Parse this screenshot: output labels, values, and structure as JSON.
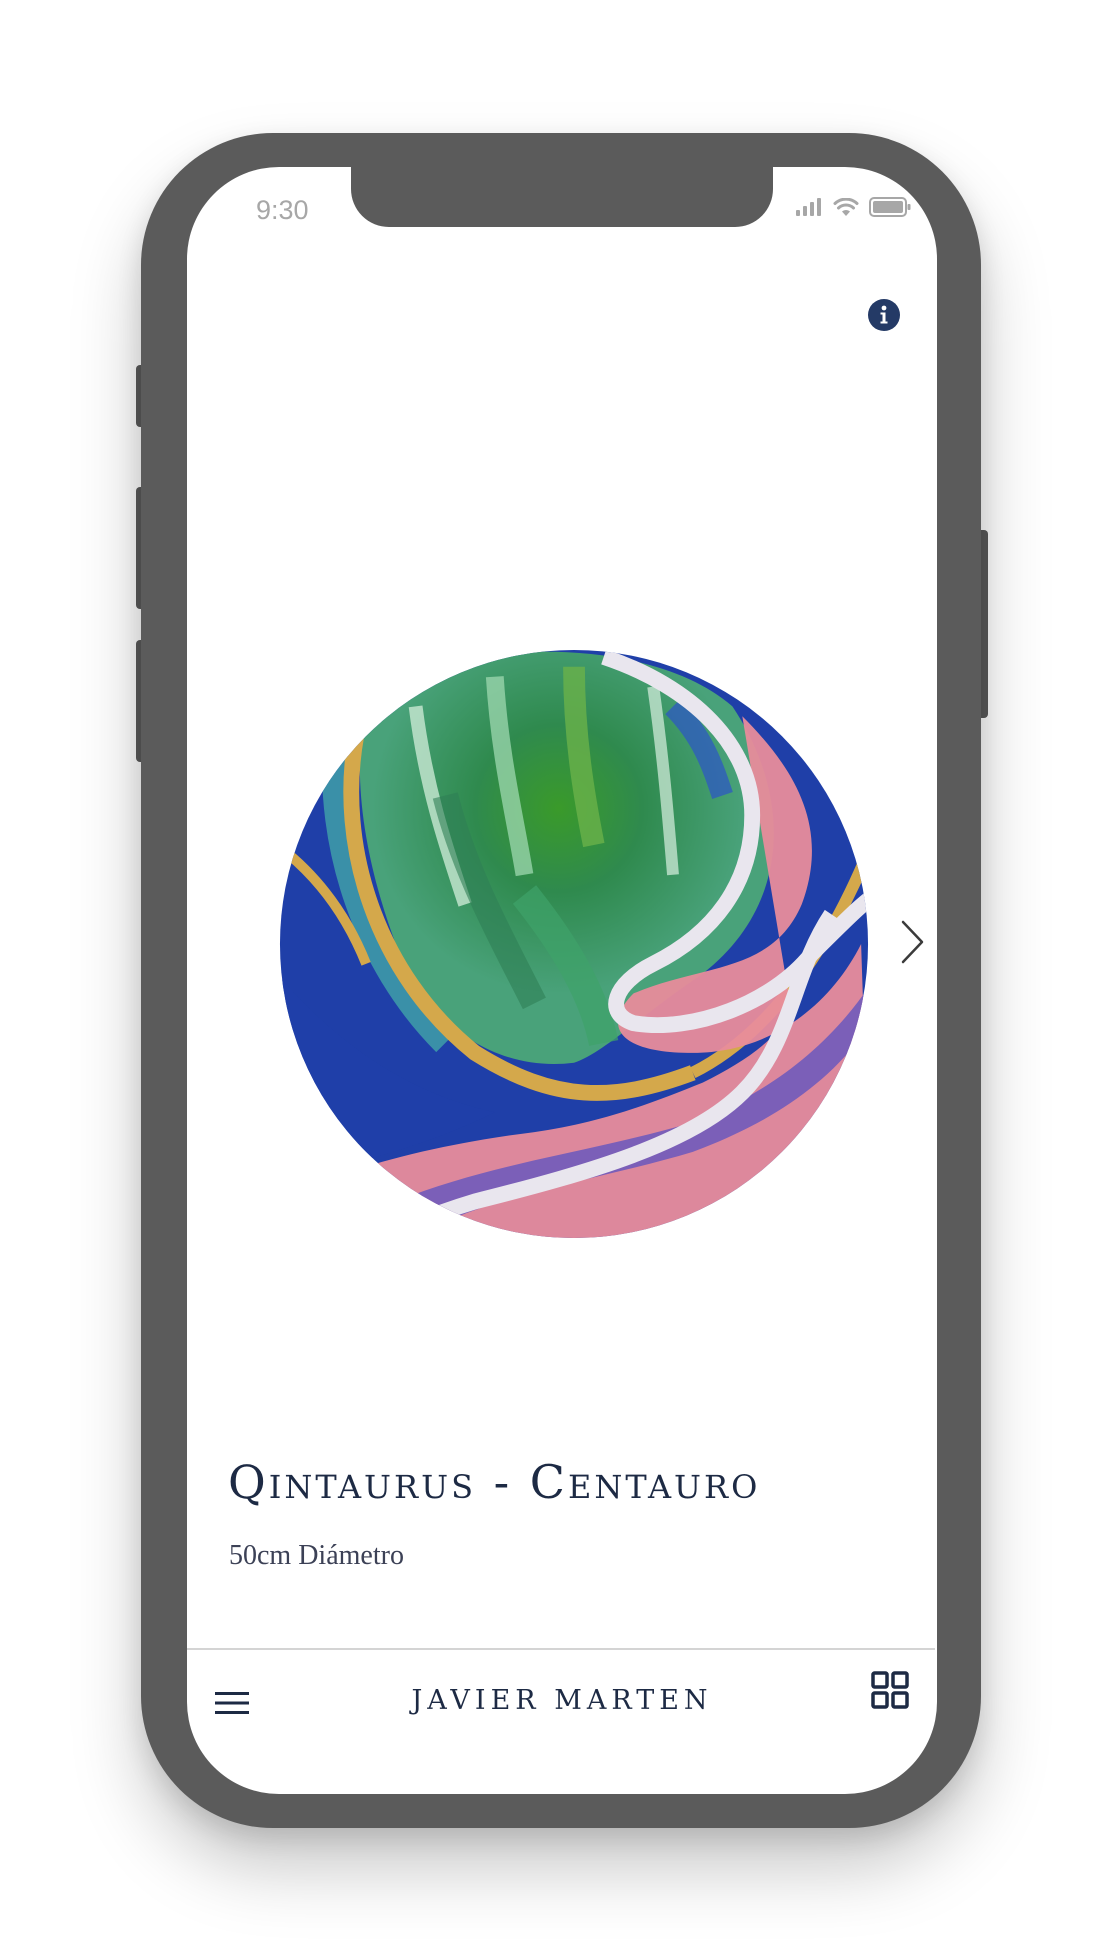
{
  "status_bar": {
    "time": "9:30",
    "icons": [
      "signal-icon",
      "wifi-icon",
      "battery-icon"
    ]
  },
  "header": {
    "info_icon": "info-icon"
  },
  "artwork": {
    "title": "Qintaurus - Centauro",
    "size": "50cm Diámetro",
    "colors": [
      "#1f3fa8",
      "#2e8b57",
      "#d4a84b",
      "#e88c9b",
      "#e9e6ee"
    ]
  },
  "navigation": {
    "next_icon": "chevron-right-icon"
  },
  "footer": {
    "menu_icon": "hamburger-menu-icon",
    "brand": "JAVIER MARTEN",
    "grid_icon": "grid-view-icon"
  },
  "colors": {
    "phone_frame": "#5b5b5b",
    "accent": "#1d2a44",
    "screen": "#ffffff"
  }
}
